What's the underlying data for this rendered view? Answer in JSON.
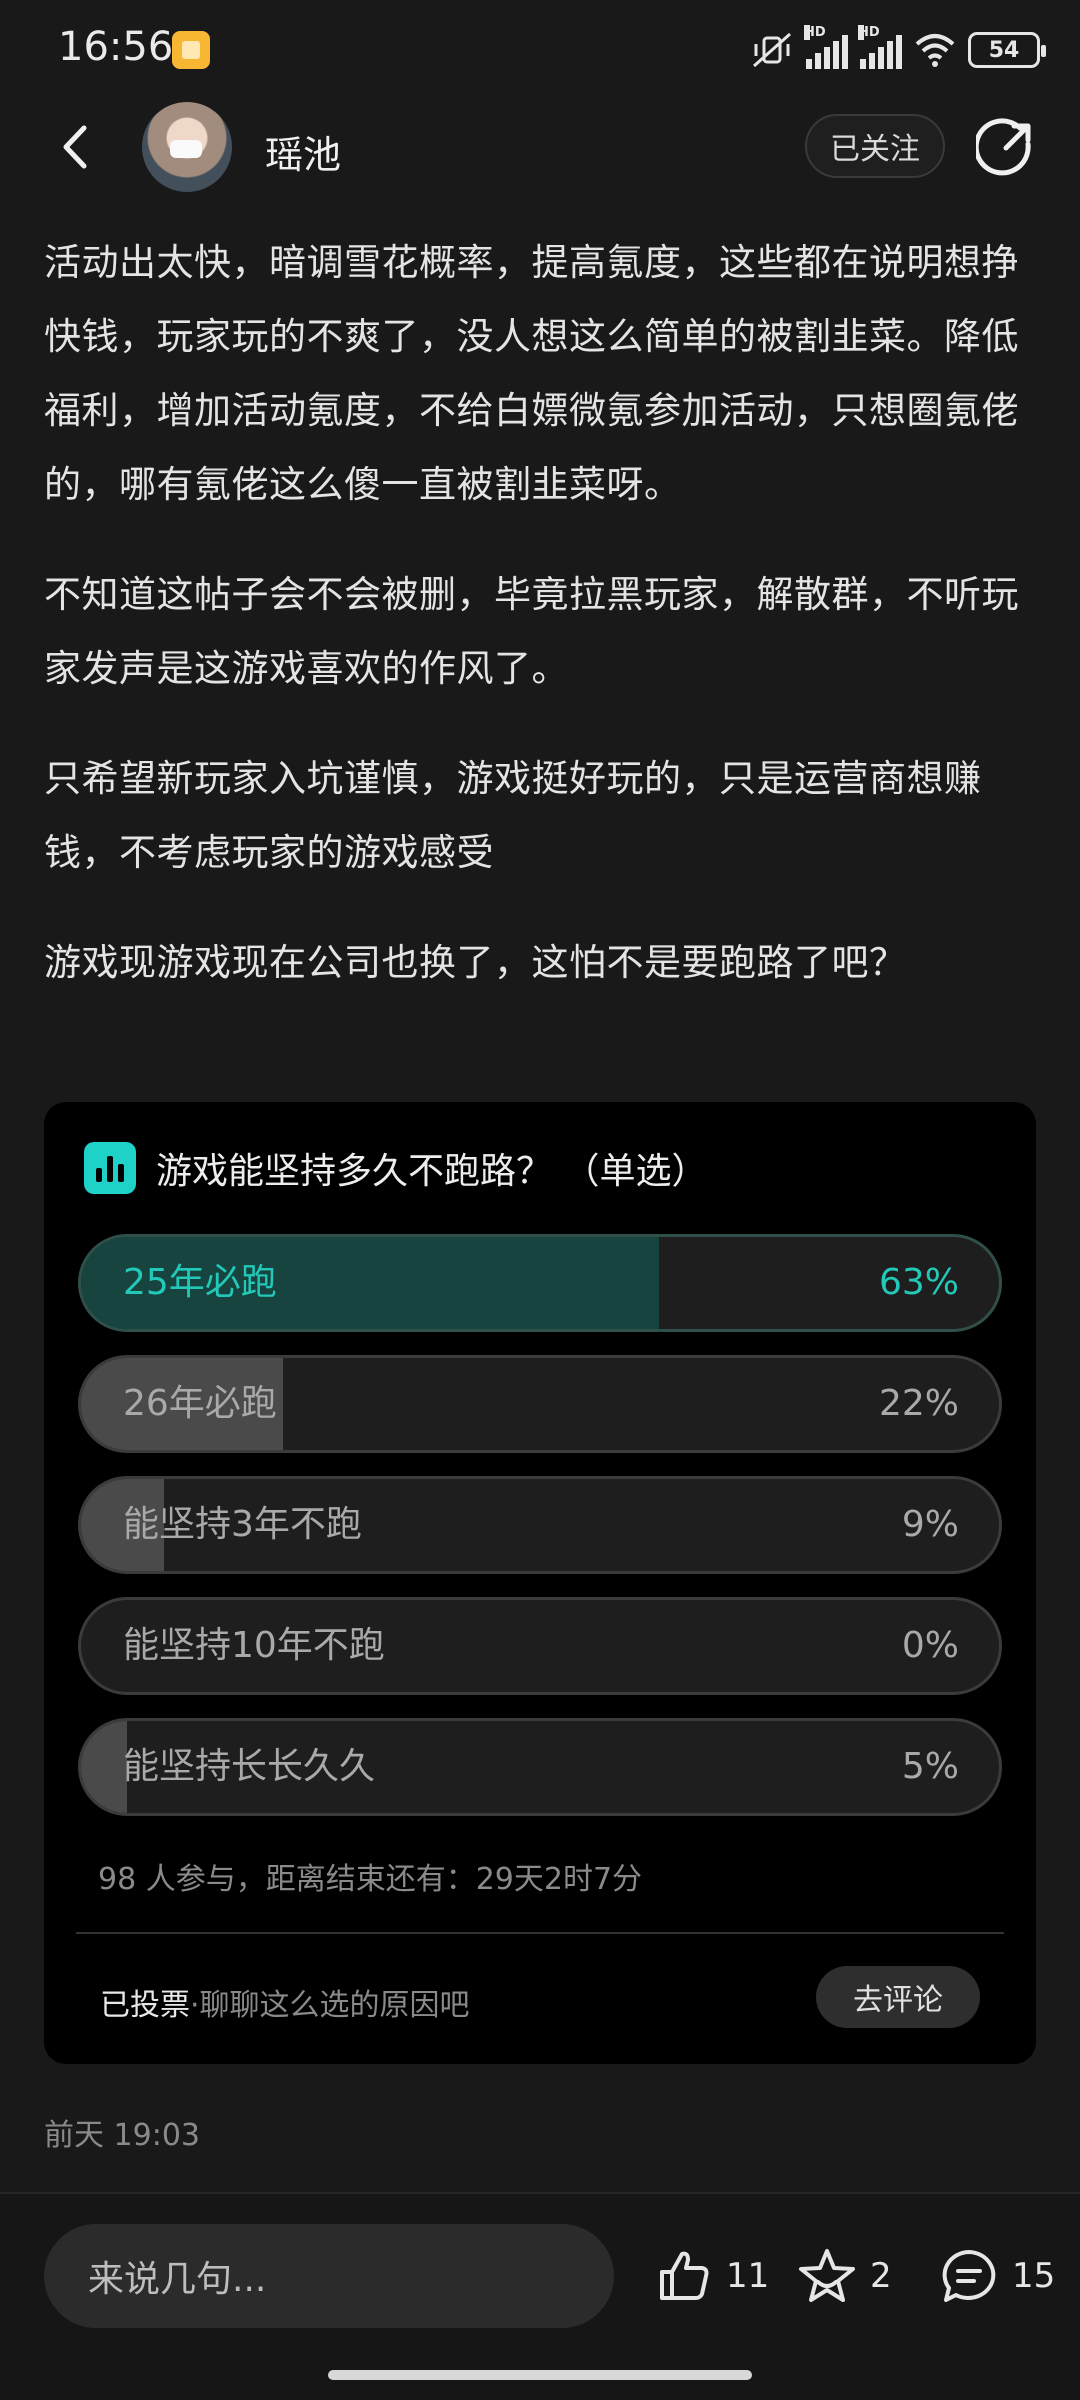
{
  "status_bar": {
    "time": "16:56",
    "battery": "54",
    "network": "HD",
    "icons": [
      "app-notification-icon",
      "mute-vibrate-icon",
      "signal-icon",
      "signal-icon",
      "wifi-icon",
      "battery-icon"
    ]
  },
  "header": {
    "author_name": "瑶池",
    "follow_label": "已关注",
    "icons": [
      "back-icon",
      "avatar",
      "share-icon"
    ]
  },
  "post": {
    "paragraphs": [
      "活动出太快，暗调雪花概率，提高氪度，这些都在说明想挣快钱，玩家玩的不爽了，没人想这么简单的被割韭菜。降低福利，增加活动氪度，不给白嫖微氪参加活动，只想圈氪佬的，哪有氪佬这么傻一直被割韭菜呀。",
      "不知道这帖子会不会被删，毕竟拉黑玩家，解散群，不听玩家发声是这游戏喜欢的作风了。",
      "只希望新玩家入坑谨慎，游戏挺好玩的，只是运营商想赚钱，不考虑玩家的游戏感受",
      "游戏现游戏现在公司也换了，这怕不是要跑路了吧？"
    ],
    "timestamp": "前天 19:03"
  },
  "poll": {
    "title": "游戏能坚持多久不跑路？ （单选）",
    "options": [
      {
        "label": "25年必跑",
        "percent_text": "63%",
        "percent": 63,
        "selected": true
      },
      {
        "label": "26年必跑",
        "percent_text": "22%",
        "percent": 22,
        "selected": false
      },
      {
        "label": "能坚持3年不跑",
        "percent_text": "9%",
        "percent": 9,
        "selected": false
      },
      {
        "label": "能坚持10年不跑",
        "percent_text": "0%",
        "percent": 0,
        "selected": false
      },
      {
        "label": "能坚持长长久久",
        "percent_text": "5%",
        "percent": 5,
        "selected": false
      }
    ],
    "meta": "98 人参与，距离结束还有：29天2时7分",
    "voted_label": "已投票",
    "voted_hint": "·聊聊这么选的原因吧",
    "comment_button": "去评论",
    "accent_color": "#22c9b8"
  },
  "bottom_bar": {
    "input_placeholder": "来说几句...",
    "likes": "11",
    "favorites": "2",
    "comments": "15"
  }
}
